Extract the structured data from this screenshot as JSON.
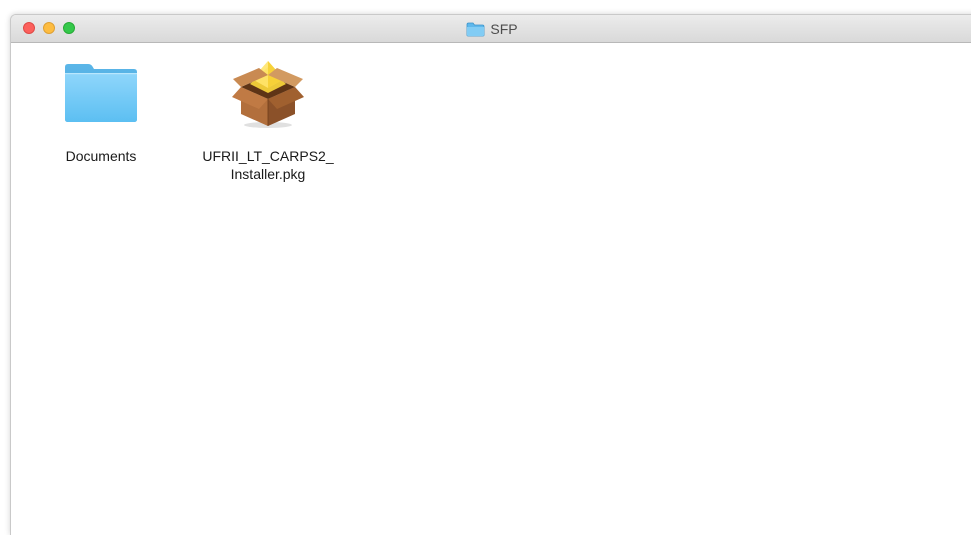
{
  "window": {
    "title": "SFP",
    "title_icon": "folder-icon",
    "traffic_lights": {
      "close_color": "#fc605c",
      "minimize_color": "#fdbc40",
      "zoom_color": "#34c84a"
    }
  },
  "items": [
    {
      "name": "Documents",
      "icon": "folder-icon",
      "label": "Documents"
    },
    {
      "name": "UFRII_LT_CARPS2_Installer.pkg",
      "icon": "package-installer-icon",
      "label": "UFRII_LT_CARPS2_\nInstaller.pkg"
    }
  ],
  "colors": {
    "folder_blue": "#6cc8f5",
    "package_brown": "#a5683a"
  }
}
